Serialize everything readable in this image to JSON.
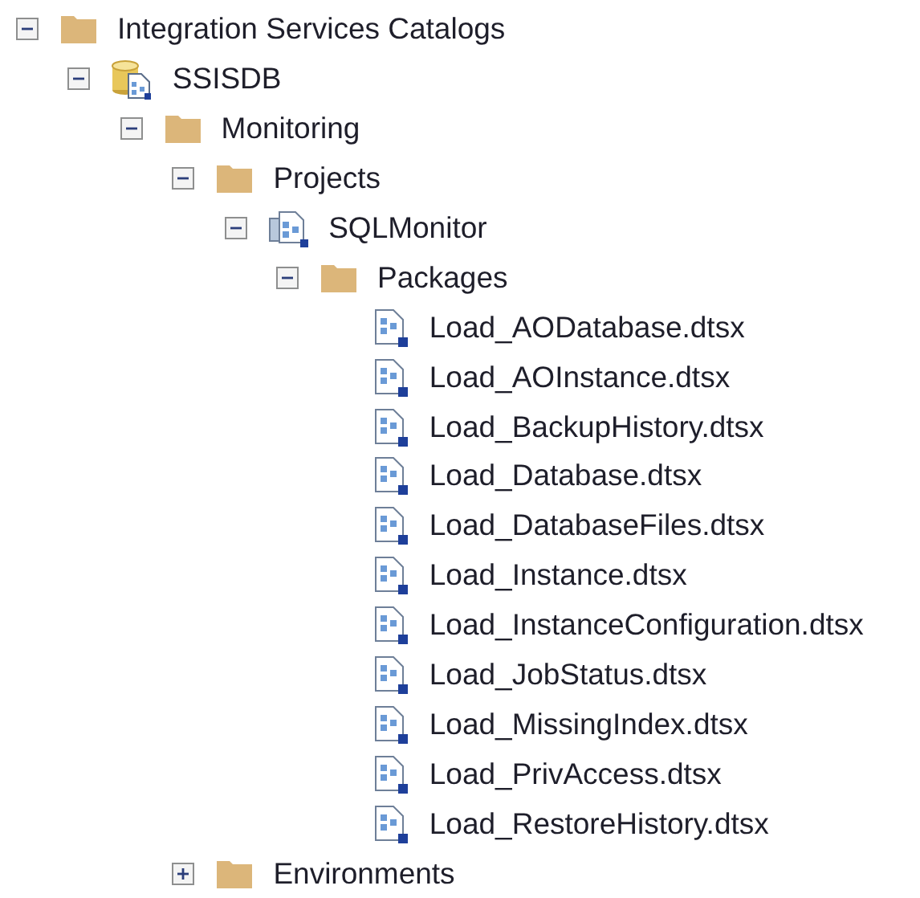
{
  "tree": [
    {
      "label": "Integration Services Catalogs",
      "kind": "folder",
      "expanded": true,
      "children": [
        {
          "label": "SSISDB",
          "kind": "database",
          "expanded": true,
          "children": [
            {
              "label": "Monitoring",
              "kind": "folder",
              "expanded": true,
              "children": [
                {
                  "label": "Projects",
                  "kind": "folder",
                  "expanded": true,
                  "children": [
                    {
                      "label": "SQLMonitor",
                      "kind": "project",
                      "expanded": true,
                      "children": [
                        {
                          "label": "Packages",
                          "kind": "folder",
                          "expanded": true,
                          "children": [
                            {
                              "label": "Load_AODatabase.dtsx",
                              "kind": "package"
                            },
                            {
                              "label": "Load_AOInstance.dtsx",
                              "kind": "package"
                            },
                            {
                              "label": "Load_BackupHistory.dtsx",
                              "kind": "package"
                            },
                            {
                              "label": "Load_Database.dtsx",
                              "kind": "package"
                            },
                            {
                              "label": "Load_DatabaseFiles.dtsx",
                              "kind": "package"
                            },
                            {
                              "label": "Load_Instance.dtsx",
                              "kind": "package"
                            },
                            {
                              "label": "Load_InstanceConfiguration.dtsx",
                              "kind": "package"
                            },
                            {
                              "label": "Load_JobStatus.dtsx",
                              "kind": "package"
                            },
                            {
                              "label": "Load_MissingIndex.dtsx",
                              "kind": "package"
                            },
                            {
                              "label": "Load_PrivAccess.dtsx",
                              "kind": "package"
                            },
                            {
                              "label": "Load_RestoreHistory.dtsx",
                              "kind": "package"
                            }
                          ]
                        }
                      ]
                    }
                  ]
                },
                {
                  "label": "Environments",
                  "kind": "folder",
                  "expanded": false
                }
              ]
            }
          ]
        }
      ]
    }
  ]
}
